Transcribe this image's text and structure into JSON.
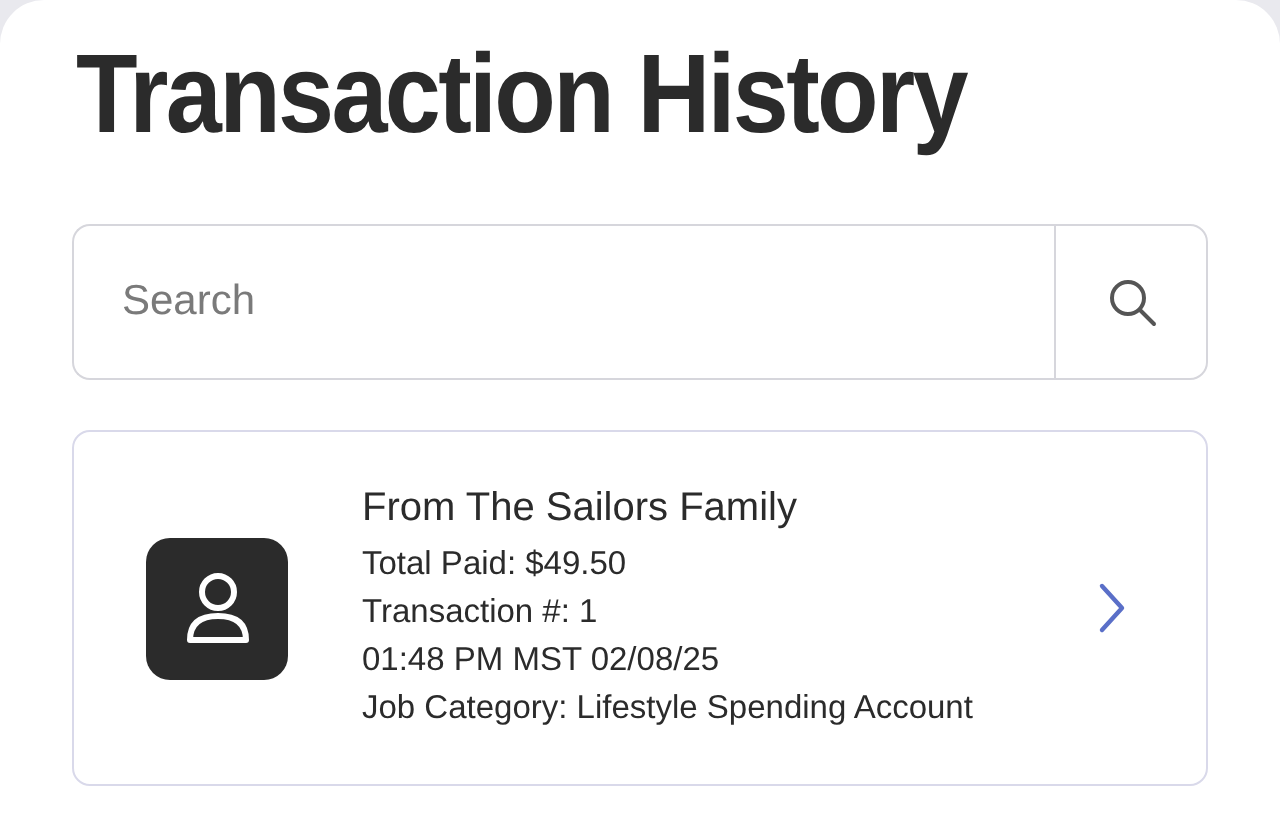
{
  "title": "Transaction History",
  "search": {
    "placeholder": "Search"
  },
  "transactions": [
    {
      "title": "From The Sailors Family",
      "lines": [
        "Total Paid: $49.50",
        "Transaction #: 1",
        "01:48 PM MST 02/08/25",
        "Job Category: Lifestyle Spending Account"
      ]
    }
  ]
}
